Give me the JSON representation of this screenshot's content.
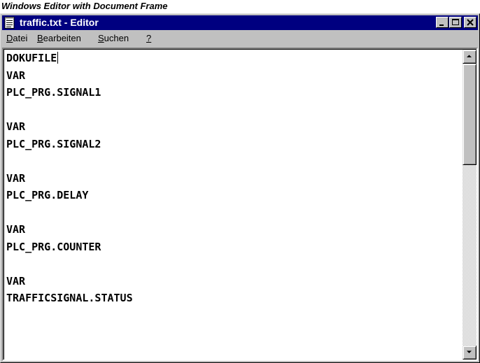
{
  "caption": "Windows Editor with Document Frame",
  "window": {
    "title": "traffic.txt - Editor",
    "icon": "notepad-icon",
    "controls": [
      "minimize-icon",
      "maximize-icon",
      "close-icon"
    ]
  },
  "menu": {
    "datei": {
      "mnemonic": "D",
      "rest": "atei"
    },
    "bearbeiten": {
      "mnemonic": "B",
      "rest": "earbeiten"
    },
    "suchen": {
      "mnemonic": "S",
      "rest": "uchen"
    },
    "help": {
      "mnemonic": "?",
      "rest": ""
    }
  },
  "document": {
    "lines": [
      "DOKUFILE",
      "VAR",
      "PLC_PRG.SIGNAL1",
      "",
      "VAR",
      "PLC_PRG.SIGNAL2",
      "",
      "VAR",
      "PLC_PRG.DELAY",
      "",
      "VAR",
      "PLC_PRG.COUNTER",
      "",
      "VAR",
      "TRAFFICSIGNAL.STATUS"
    ],
    "caret_line": 0
  },
  "scrollbar": {
    "position": 0,
    "visible_fraction": 0.36,
    "up_icon": "arrow-up-icon",
    "down_icon": "arrow-down-icon"
  }
}
